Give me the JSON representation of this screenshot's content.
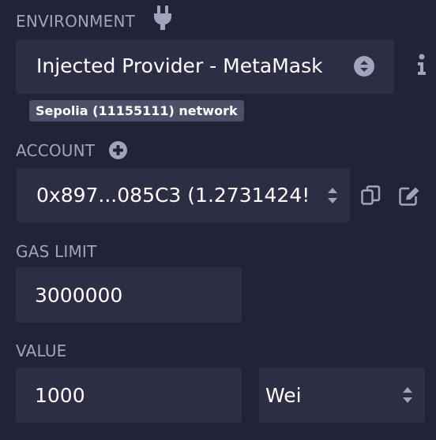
{
  "environment": {
    "label": "ENVIRONMENT",
    "label_icon": "plug-icon",
    "selected_provider": "Injected Provider - MetaMask",
    "info_icon": "info-icon",
    "network_badge": "Sepolia (11155111) network"
  },
  "account": {
    "label": "ACCOUNT",
    "add_icon": "plus-circle-icon",
    "selected_account": "0x897...085C3 (1.2731424!",
    "copy_icon": "copy-icon",
    "edit_icon": "edit-icon"
  },
  "gas_limit": {
    "label": "GAS LIMIT",
    "value": "3000000"
  },
  "value": {
    "label": "VALUE",
    "amount": "1000",
    "unit": "Wei"
  },
  "colors": {
    "background": "#222336",
    "field_background": "#2d2e44",
    "label_text": "#a2a3bd",
    "value_text": "#ffffff",
    "badge_background": "#4d4f66"
  }
}
